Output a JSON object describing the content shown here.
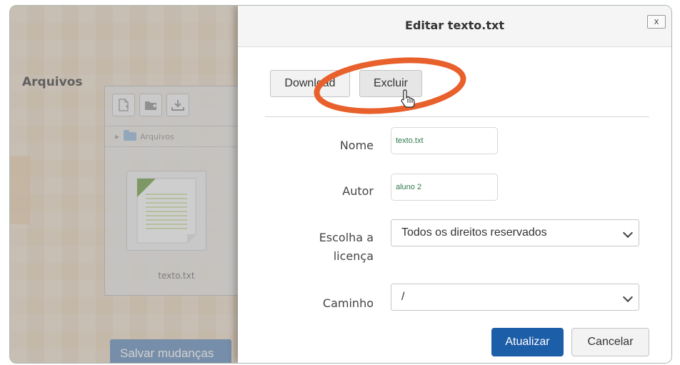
{
  "background": {
    "section_title": "Arquivos",
    "file_manager": {
      "toolbar_icons": [
        "new-file-icon",
        "new-folder-icon",
        "download-icon"
      ],
      "path_label": "Arquivos",
      "file_name": "texto.txt"
    },
    "save_button_label": "Salvar mudanças"
  },
  "modal": {
    "title": "Editar texto.txt",
    "close_label": "x",
    "download_label": "Download",
    "delete_label": "Excluir",
    "fields": {
      "name_label": "Nome",
      "name_value": "texto.txt",
      "author_label": "Autor",
      "author_value": "aluno 2",
      "license_label": "Escolha a licença",
      "license_value": "Todos os direitos reservados",
      "path_label": "Caminho",
      "path_value": "/"
    },
    "update_label": "Atualizar",
    "cancel_label": "Cancelar"
  },
  "colors": {
    "primary": "#1d5ea8",
    "highlight_ring": "#e8602c",
    "field_text": "#2f7a4c"
  }
}
